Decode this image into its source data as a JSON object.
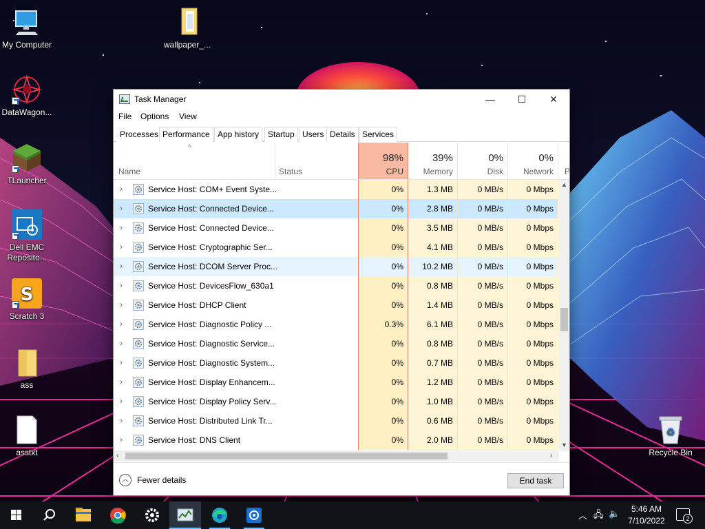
{
  "desktop": {
    "icons": [
      {
        "label": "My Computer",
        "icon": "computer-icon"
      },
      {
        "label": "wallpaper_...",
        "icon": "folder-icon"
      },
      {
        "label": "DataWagon...",
        "icon": "datawagon-app-icon"
      },
      {
        "label": "TLauncher",
        "icon": "minecraft-block-icon"
      },
      {
        "label": "Dell EMC Reposito...",
        "icon": "dell-emc-folder-icon"
      },
      {
        "label": "Scratch 3",
        "icon": "scratch-icon"
      },
      {
        "label": "ass",
        "icon": "folder-icon"
      },
      {
        "label": "asstxt",
        "icon": "text-file-icon"
      },
      {
        "label": "Recycle Bin",
        "icon": "recycle-bin-icon"
      }
    ]
  },
  "window": {
    "title": "Task Manager",
    "controls": {
      "minimize": "—",
      "maximize": "☐",
      "close": "✕"
    },
    "menu": [
      "File",
      "Options",
      "View"
    ],
    "tabs": [
      "Processes",
      "Performance",
      "App history",
      "Startup",
      "Users",
      "Details",
      "Services"
    ],
    "active_tab": "Processes",
    "columns": {
      "name": "Name",
      "status": "Status",
      "cpu": {
        "pct": "98%",
        "label": "CPU"
      },
      "memory": {
        "pct": "39%",
        "label": "Memory"
      },
      "disk": {
        "pct": "0%",
        "label": "Disk"
      },
      "network": {
        "pct": "0%",
        "label": "Network"
      },
      "power": {
        "label": "P"
      }
    },
    "rows": [
      {
        "name": "Service Host: COM+ Event Syste...",
        "cpu": "0%",
        "memory": "1.3 MB",
        "disk": "0 MB/s",
        "network": "0 Mbps"
      },
      {
        "name": "Service Host: Connected Device...",
        "cpu": "0%",
        "memory": "2.8 MB",
        "disk": "0 MB/s",
        "network": "0 Mbps"
      },
      {
        "name": "Service Host: Connected Device...",
        "cpu": "0%",
        "memory": "3.5 MB",
        "disk": "0 MB/s",
        "network": "0 Mbps"
      },
      {
        "name": "Service Host: Cryptographic Ser...",
        "cpu": "0%",
        "memory": "4.1 MB",
        "disk": "0 MB/s",
        "network": "0 Mbps"
      },
      {
        "name": "Service Host: DCOM Server Proc...",
        "cpu": "0%",
        "memory": "10.2 MB",
        "disk": "0 MB/s",
        "network": "0 Mbps"
      },
      {
        "name": "Service Host: DevicesFlow_630a1",
        "cpu": "0%",
        "memory": "0.8 MB",
        "disk": "0 MB/s",
        "network": "0 Mbps"
      },
      {
        "name": "Service Host: DHCP Client",
        "cpu": "0%",
        "memory": "1.4 MB",
        "disk": "0 MB/s",
        "network": "0 Mbps"
      },
      {
        "name": "Service Host: Diagnostic Policy ...",
        "cpu": "0.3%",
        "memory": "6.1 MB",
        "disk": "0 MB/s",
        "network": "0 Mbps"
      },
      {
        "name": "Service Host: Diagnostic Service...",
        "cpu": "0%",
        "memory": "0.8 MB",
        "disk": "0 MB/s",
        "network": "0 Mbps"
      },
      {
        "name": "Service Host: Diagnostic System...",
        "cpu": "0%",
        "memory": "0.7 MB",
        "disk": "0 MB/s",
        "network": "0 Mbps"
      },
      {
        "name": "Service Host: Display Enhancem...",
        "cpu": "0%",
        "memory": "1.2 MB",
        "disk": "0 MB/s",
        "network": "0 Mbps"
      },
      {
        "name": "Service Host: Display Policy Serv...",
        "cpu": "0%",
        "memory": "1.0 MB",
        "disk": "0 MB/s",
        "network": "0 Mbps"
      },
      {
        "name": "Service Host: Distributed Link Tr...",
        "cpu": "0%",
        "memory": "0.6 MB",
        "disk": "0 MB/s",
        "network": "0 Mbps"
      },
      {
        "name": "Service Host: DNS Client",
        "cpu": "0%",
        "memory": "2.0 MB",
        "disk": "0 MB/s",
        "network": "0 Mbps"
      }
    ],
    "selected_row": 1,
    "hover_row": 4,
    "footer": {
      "fewer_details": "Fewer details",
      "end_task": "End task"
    }
  },
  "taskbar": {
    "apps": [
      "start-icon",
      "search-icon",
      "file-explorer-icon",
      "chrome-icon",
      "settings-icon",
      "task-manager-icon",
      "edge-icon",
      "control-panel-icon"
    ],
    "active_app": "task-manager-icon",
    "clock": {
      "time": "5:46 AM",
      "date": "7/10/2022"
    },
    "notifications": "2"
  },
  "colors": {
    "cpu_header_hot": "#f9b9a2",
    "cpu_column": "#fff0c4",
    "other_columns": "#fff5d6",
    "selected_row": "#cce8ff",
    "hover_row": "#e5f3ff"
  }
}
